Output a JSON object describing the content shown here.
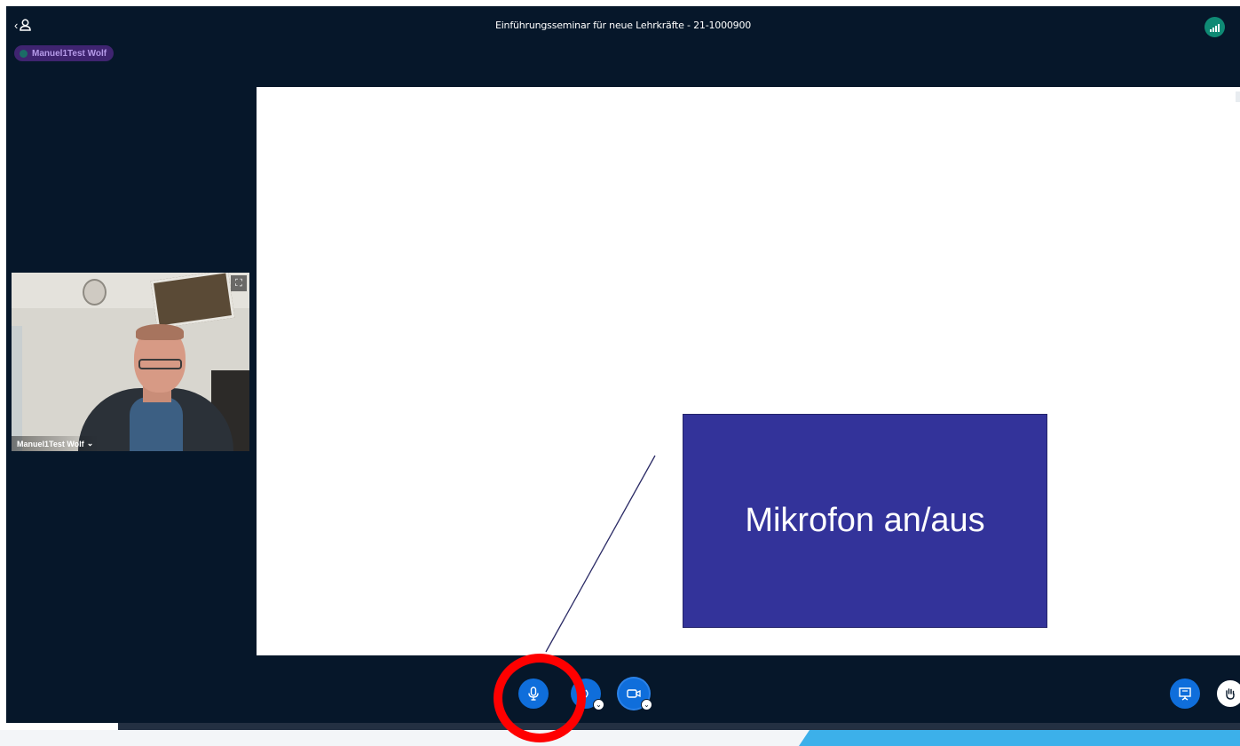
{
  "meeting": {
    "title": "Einführungsseminar für neue Lehrkräfte - 21-1000900"
  },
  "talking_indicator": {
    "name": "Manuel1Test Wolf"
  },
  "webcam": {
    "user_name": "Manuel1Test Wolf",
    "name_chevron": "⌄",
    "fullscreen_glyph": "⛶"
  },
  "annotation": {
    "callout_text": "Mikrofon an/aus",
    "callout_color": "#33339a",
    "circle_color": "#ff0000"
  },
  "icons": {
    "users_toggle": "users-icon",
    "connection": "signal-bars-icon",
    "mic": "microphone-icon",
    "audio": "speaker-icon",
    "camera": "video-camera-icon",
    "present": "presentation-screen-icon",
    "raise_hand": "hand-icon"
  },
  "colors": {
    "background": "#06172a",
    "action_blue": "#0f6edb",
    "connection_green": "#0f8a74",
    "talking_pill": "#3f2470"
  }
}
